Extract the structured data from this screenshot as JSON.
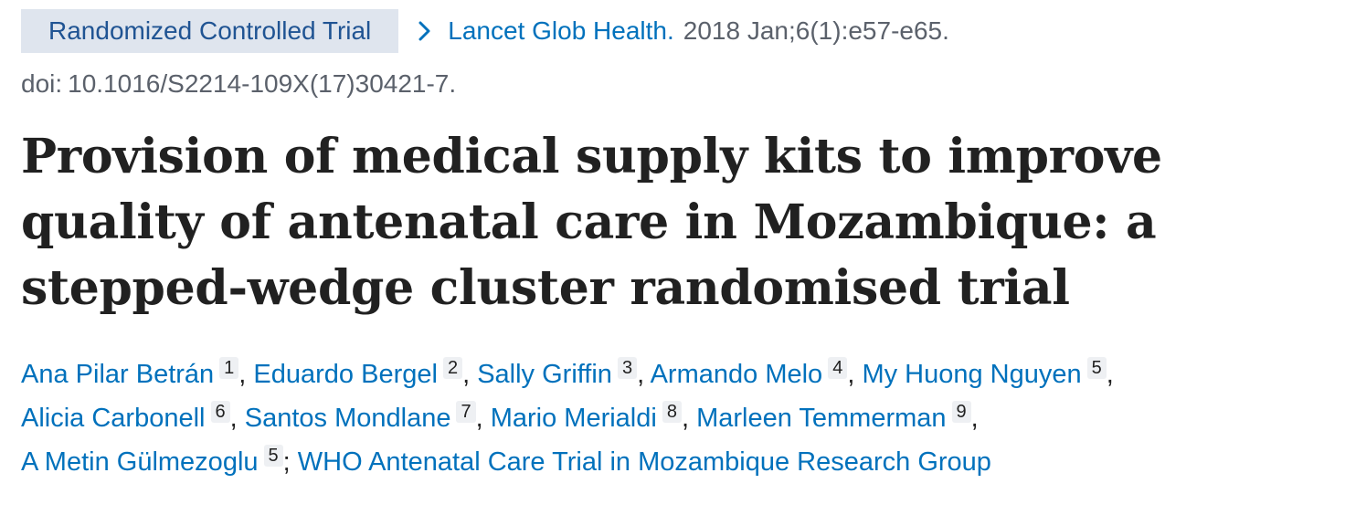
{
  "publication_type": "Randomized Controlled Trial",
  "journal": {
    "name": "Lancet Glob Health.",
    "citation": "2018 Jan;6(1):e57-e65."
  },
  "doi": {
    "label": "doi:",
    "value": "10.1016/S2214-109X(17)30421-7."
  },
  "title": "Provision of medical supply kits to improve quality of antenatal care in Mozambique: a stepped-wedge cluster randomised trial",
  "authors": [
    {
      "name": "Ana Pilar Betrán",
      "aff": "1",
      "sep": ","
    },
    {
      "name": "Eduardo Bergel",
      "aff": "2",
      "sep": ","
    },
    {
      "name": "Sally Griffin",
      "aff": "3",
      "sep": ","
    },
    {
      "name": "Armando Melo",
      "aff": "4",
      "sep": ","
    },
    {
      "name": "My Huong Nguyen",
      "aff": "5",
      "sep": ","
    },
    {
      "name": "Alicia Carbonell",
      "aff": "6",
      "sep": ","
    },
    {
      "name": "Santos Mondlane",
      "aff": "7",
      "sep": ","
    },
    {
      "name": "Mario Merialdi",
      "aff": "8",
      "sep": ","
    },
    {
      "name": "Marleen Temmerman",
      "aff": "9",
      "sep": ","
    },
    {
      "name": "A Metin Gülmezoglu",
      "aff": "5",
      "sep": ";"
    }
  ],
  "collective_author": "WHO Antenatal Care Trial in Mozambique Research Group",
  "icons": {
    "journal_chevron": "chevron-right-icon"
  },
  "colors": {
    "link": "#0071bc",
    "badge_bg": "#dfe5ee",
    "badge_text": "#205493",
    "muted": "#5b616b",
    "aff_bg": "#eef0f3"
  }
}
